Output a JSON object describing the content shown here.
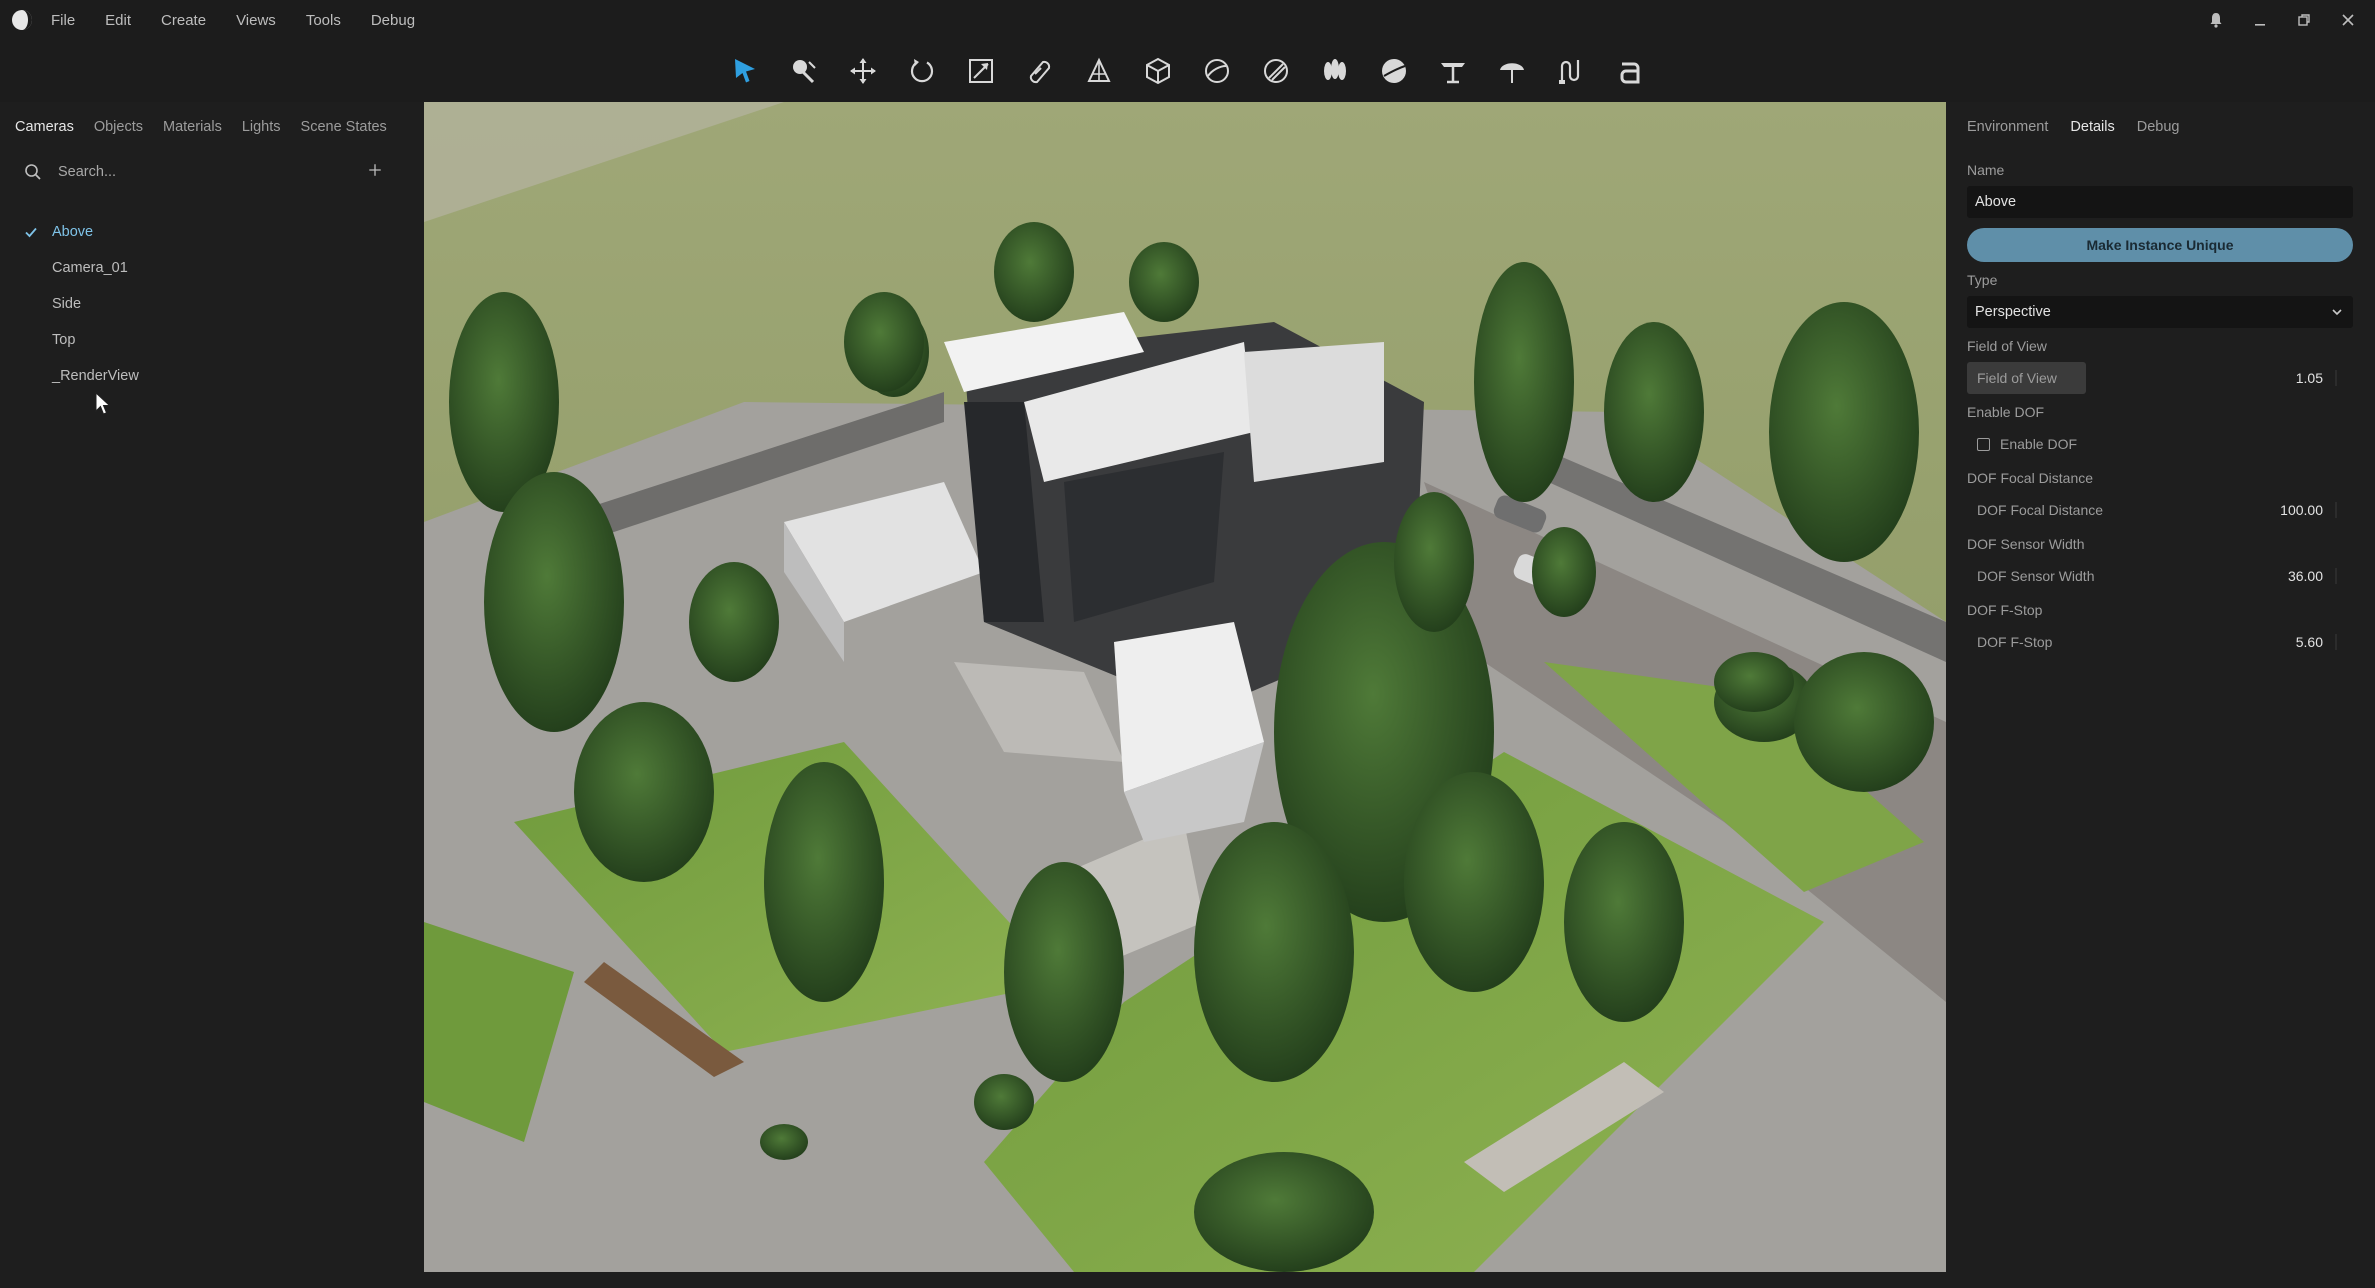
{
  "menu": {
    "items": [
      "File",
      "Edit",
      "Create",
      "Views",
      "Tools",
      "Debug"
    ]
  },
  "window": {
    "icons": [
      "bell-icon",
      "minimize-icon",
      "restore-icon",
      "close-icon"
    ]
  },
  "toolbar": {
    "tools": [
      "select",
      "paint",
      "move",
      "rotate",
      "scale",
      "measure",
      "align",
      "box",
      "sphere-slice",
      "cylinder",
      "vegetation",
      "sphere",
      "table",
      "umbrella",
      "path",
      "text"
    ],
    "accent": "#2f9fe0"
  },
  "left_panel": {
    "tabs": [
      "Cameras",
      "Objects",
      "Materials",
      "Lights",
      "Scene States"
    ],
    "active_tab": "Cameras",
    "search_placeholder": "Search...",
    "cameras": [
      "Above",
      "Camera_01",
      "Side",
      "Top",
      "_RenderView"
    ],
    "selected_camera": "Above",
    "selected_color": "#7fc3e8"
  },
  "right_panel": {
    "tabs": [
      "Environment",
      "Details",
      "Debug"
    ],
    "active_tab": "Details",
    "name_label": "Name",
    "name_value": "Above",
    "make_unique_label": "Make Instance Unique",
    "type_label": "Type",
    "type_value": "Perspective",
    "fov_label": "Field of View",
    "fov_field_label": "Field of View",
    "fov_value": "1.05",
    "dof_label": "Enable DOF",
    "dof_checkbox_label": "Enable DOF",
    "dof_enabled": false,
    "focal_label": "DOF Focal Distance",
    "focal_field_label": "DOF Focal Distance",
    "focal_value": "100.00",
    "sensor_label": "DOF Sensor Width",
    "sensor_field_label": "DOF Sensor Width",
    "sensor_value": "36.00",
    "fstop_label": "DOF F-Stop",
    "fstop_field_label": "DOF F-Stop",
    "fstop_value": "5.60",
    "button_color": "#5f8fa9"
  }
}
